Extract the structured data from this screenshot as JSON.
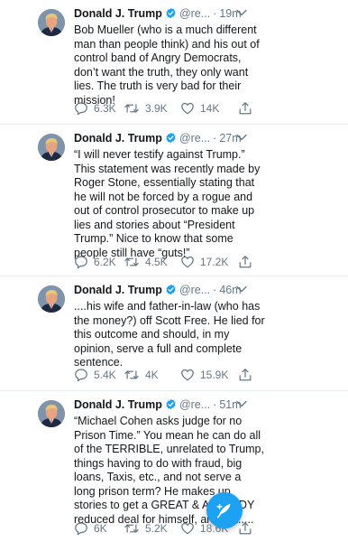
{
  "colors": {
    "accent": "#1da1f2",
    "text": "#14171a",
    "secondary": "#657786",
    "divider": "#e6ecf0"
  },
  "icons": {
    "reply": "speech-bubble-icon",
    "retweet": "retweet-icon",
    "like": "heart-icon",
    "share": "share-icon",
    "verified": "verified-badge-icon",
    "menu": "chevron-down-icon",
    "compose": "compose-feather-icon"
  },
  "tweets": [
    {
      "name": "Donald J. Trump",
      "handle": "@re...",
      "dot": "·",
      "time": "19m",
      "text": "Bob Mueller (who is a much different man than people think) and his out of control band of Angry Democrats, don’t want the truth, they only want lies. The truth is very bad for their mission!",
      "replies": "6.3K",
      "retweets": "3.9K",
      "likes": "14K"
    },
    {
      "name": "Donald J. Trump",
      "handle": "@re...",
      "dot": "·",
      "time": "27m",
      "text": "“I will never testify against Trump.” This statement was recently made by Roger Stone, essentially stating that he will not be forced by a rogue and out of control prosecutor to make up lies and stories about “President Trump.” Nice to know that some people still have “guts!”",
      "replies": "6.2K",
      "retweets": "4.5K",
      "likes": "17.2K"
    },
    {
      "name": "Donald J. Trump",
      "handle": "@re...",
      "dot": "·",
      "time": "46m",
      "text": "....his wife and father-in-law (who has the money?) off Scott Free. He lied for this outcome and should, in my opinion, serve a full and complete sentence.",
      "replies": "5.4K",
      "retweets": "4K",
      "likes": "15.9K"
    },
    {
      "name": "Donald J. Trump",
      "handle": "@re...",
      "dot": "·",
      "time": "51m",
      "text": "“Michael Cohen asks judge for no Prison Time.” You mean he can do all of the TERRIBLE, unrelated to Trump, things having to do with fraud, big loans, Taxis, etc., and not serve a long prison term? He makes up stories to get a GREAT & ALREADY reduced deal for himself, and get.....",
      "replies": "6K",
      "retweets": "5.2K",
      "likes": "18.6K"
    }
  ]
}
